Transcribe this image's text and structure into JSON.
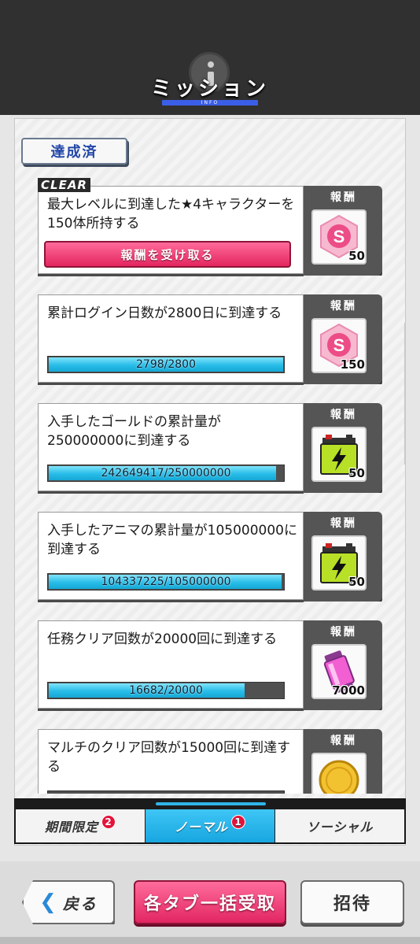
{
  "header": {
    "title": "ミッション",
    "subtitle": "INFO"
  },
  "section": {
    "label": "達成済"
  },
  "reward_label": "報酬",
  "missions": [
    {
      "stamp": "CLEAR",
      "text": "最大レベルに到達した★4キャラクターを150体所持する",
      "claim_label": "報酬を受け取る",
      "reward_icon": "s-gem-icon",
      "reward_qty": "50"
    },
    {
      "text": "累計ログイン日数が2800日に到達する",
      "progress_text": "2798/2800",
      "progress": 0.9993,
      "reward_icon": "s-gem-icon",
      "reward_qty": "150"
    },
    {
      "text": "入手したゴールドの累計量が250000000に到達する",
      "progress_text": "242649417/250000000",
      "progress": 0.9706,
      "reward_icon": "battery-icon",
      "reward_qty": "50"
    },
    {
      "text": "入手したアニマの累計量が105000000に到達する",
      "progress_text": "104337225/105000000",
      "progress": 0.9937,
      "reward_icon": "battery-icon",
      "reward_qty": "50"
    },
    {
      "text": "任務クリア回数が20000回に到達する",
      "progress_text": "16682/20000",
      "progress": 0.8341,
      "reward_icon": "energy-canister-icon",
      "reward_qty": "7000"
    },
    {
      "text": "マルチのクリア回数が15000回に到達する",
      "reward_icon": "gold-coin-icon"
    }
  ],
  "tabs": [
    {
      "label": "期間限定",
      "badge": "2"
    },
    {
      "label": "ノーマル",
      "badge": "1"
    },
    {
      "label": "ソーシャル"
    }
  ],
  "footer": {
    "back_label": "戻る",
    "claim_all_label": "各タブ一括受取",
    "invite_label": "招待"
  },
  "colors": {
    "accent_blue": "#2fb5e8",
    "claim_pink": "#e3255f",
    "header_bg": "#303030"
  }
}
